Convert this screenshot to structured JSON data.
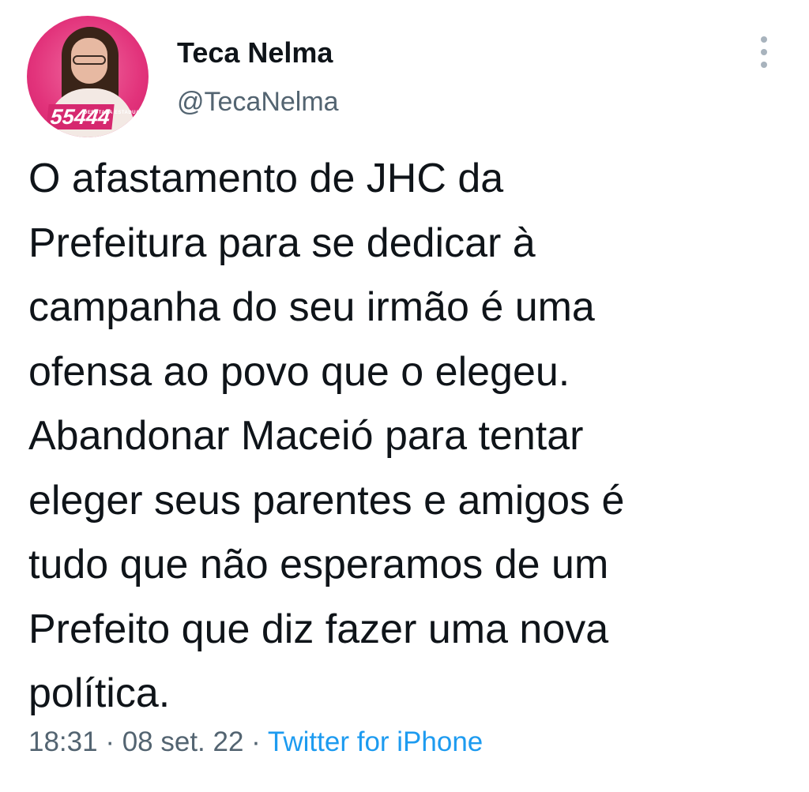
{
  "author": {
    "display_name": "Teca Nelma",
    "handle": "@TecaNelma",
    "avatar": {
      "badge_caption": "DEPUTADA ESTADUAL",
      "badge_number": "55444",
      "background_color": "#e2337b"
    }
  },
  "menu": {
    "icon": "more-vertical-icon"
  },
  "tweet": {
    "lines": [
      "O afastamento de JHC da",
      "Prefeitura para se dedicar à",
      "campanha do seu irmão é uma",
      "ofensa ao povo que o elegeu.",
      "Abandonar Maceió para tentar",
      "eleger seus parentes e amigos é",
      "tudo que não esperamos de um",
      "Prefeito que diz fazer uma nova",
      "política."
    ]
  },
  "meta": {
    "time": "18:31",
    "separator_1": " · ",
    "date": "08 set. 22",
    "separator_2": " · ",
    "source": "Twitter for iPhone"
  },
  "colors": {
    "text_primary": "#0f1419",
    "text_secondary": "#536471",
    "link": "#1d9bf0"
  }
}
